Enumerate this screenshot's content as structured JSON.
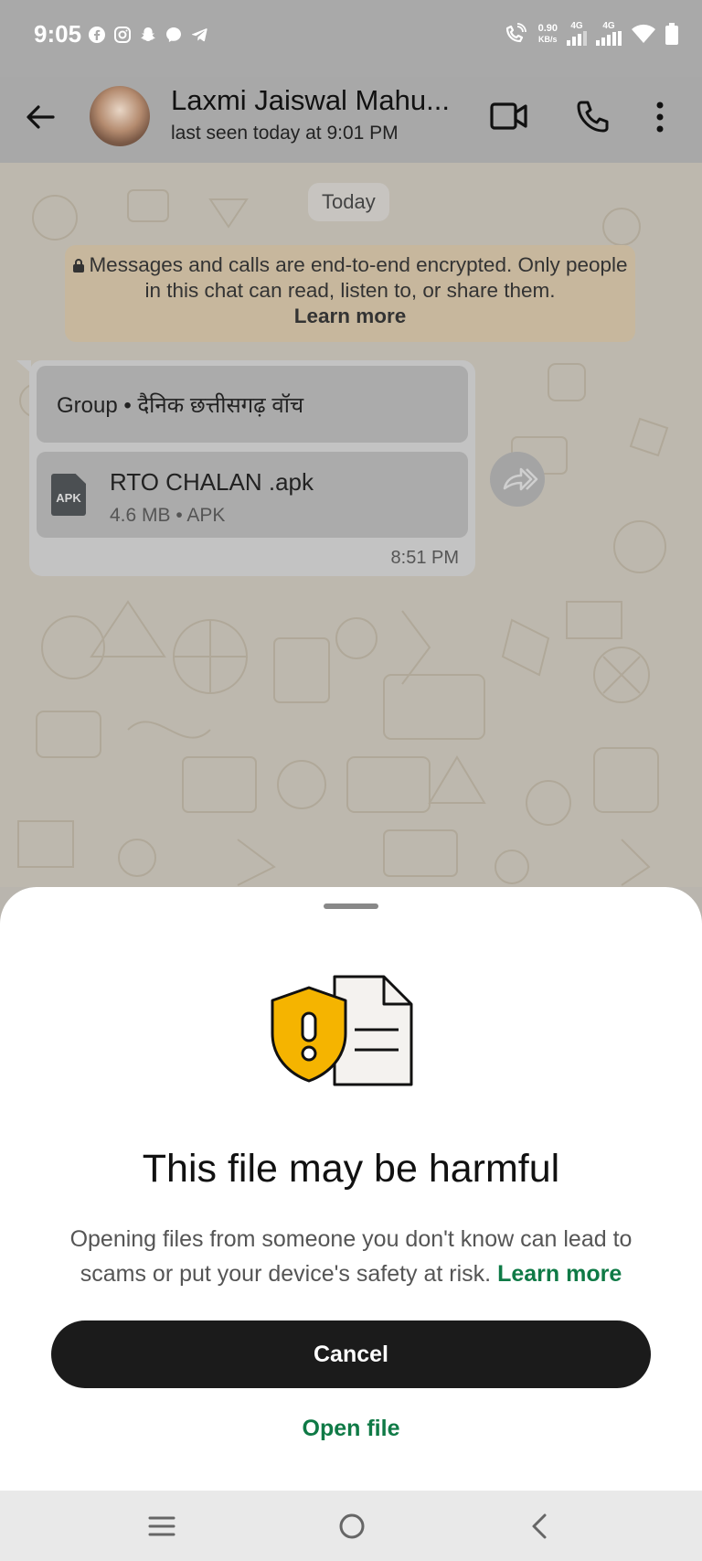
{
  "status_bar": {
    "time": "9:05",
    "net_speed": "0.90",
    "net_speed_unit": "KB/s",
    "network_1": "4G",
    "network_2": "4G",
    "app_icons": [
      "facebook-icon",
      "instagram-icon",
      "snapchat-icon",
      "messenger-icon",
      "telegram-icon"
    ]
  },
  "header": {
    "contact_name": "Laxmi Jaiswal Mahu...",
    "last_seen": "last seen today at 9:01 PM",
    "icons": [
      "back-arrow-icon",
      "video-call-icon",
      "voice-call-icon",
      "more-options-icon"
    ]
  },
  "chat": {
    "date_chip": "Today",
    "encryption_notice": "Messages and calls are end-to-end encrypted. Only people in this chat can read, listen to, or share them.",
    "encryption_learn_more": "Learn more",
    "message": {
      "group_label": "Group • दैनिक छत्तीसगढ़ वॉच",
      "file_icon_label": "APK",
      "file_name": "RTO CHALAN .apk",
      "file_meta": "4.6 MB • APK",
      "time": "8:51 PM"
    }
  },
  "sheet": {
    "title": "This file may be harmful",
    "body": "Opening files from someone you don't know can lead to scams or put your device's safety at risk.",
    "learn_more": "Learn more",
    "cancel_label": "Cancel",
    "open_file_label": "Open file"
  },
  "colors": {
    "accent_green": "#0f7a46",
    "warning_yellow": "#f5b400",
    "button_dark": "#1b1b1b"
  }
}
